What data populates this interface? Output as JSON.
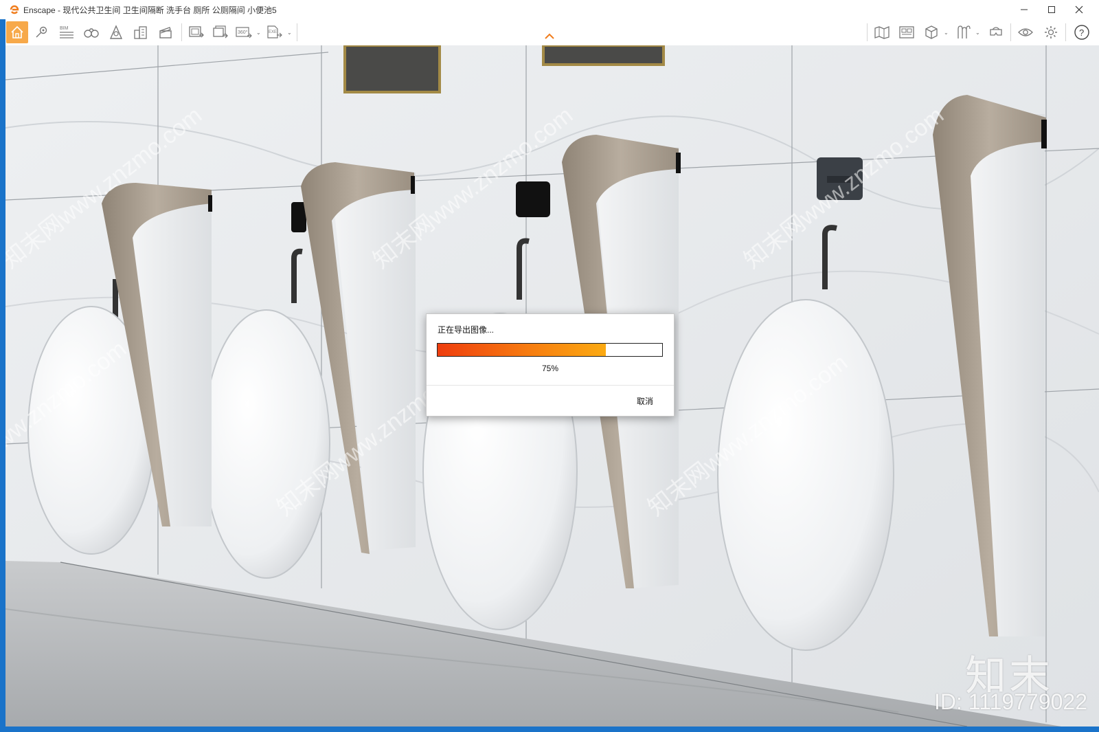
{
  "window": {
    "title": "Enscape - 现代公共卫生间 卫生间隔断 洗手台 厕所 公厕隔间 小便池5",
    "minimize_icon": "minimize-icon",
    "maximize_icon": "maximize-icon",
    "close_icon": "close-icon"
  },
  "toolbar": {
    "bim_label": "BIM",
    "pano_label": "360°",
    "exe_label": "EXE",
    "left_icons": [
      "home-icon",
      "location-icon",
      "bim-icon",
      "binoculars-icon",
      "perspective-icon",
      "buildings-icon",
      "clapper-icon",
      "screenshot-export-icon",
      "batch-render-icon",
      "panorama-icon",
      "exe-export-icon"
    ],
    "right_icons": [
      "map-icon",
      "asset-library-icon",
      "cube-icon",
      "material-icon",
      "vr-headset-icon",
      "visual-settings-icon",
      "settings-icon",
      "help-icon"
    ]
  },
  "dialog": {
    "title": "正在导出图像...",
    "progress_percent": 75,
    "progress_text": "75%",
    "cancel_label": "取消"
  },
  "watermark": {
    "brand": "知末",
    "id_text": "ID: 1119779022",
    "repeat_text": "知末网www.znzmo.com"
  },
  "colors": {
    "accent": "#f7a94a",
    "progress_start": "#ee3d0e",
    "progress_end": "#fbaa12",
    "frame": "#1a73c9"
  }
}
